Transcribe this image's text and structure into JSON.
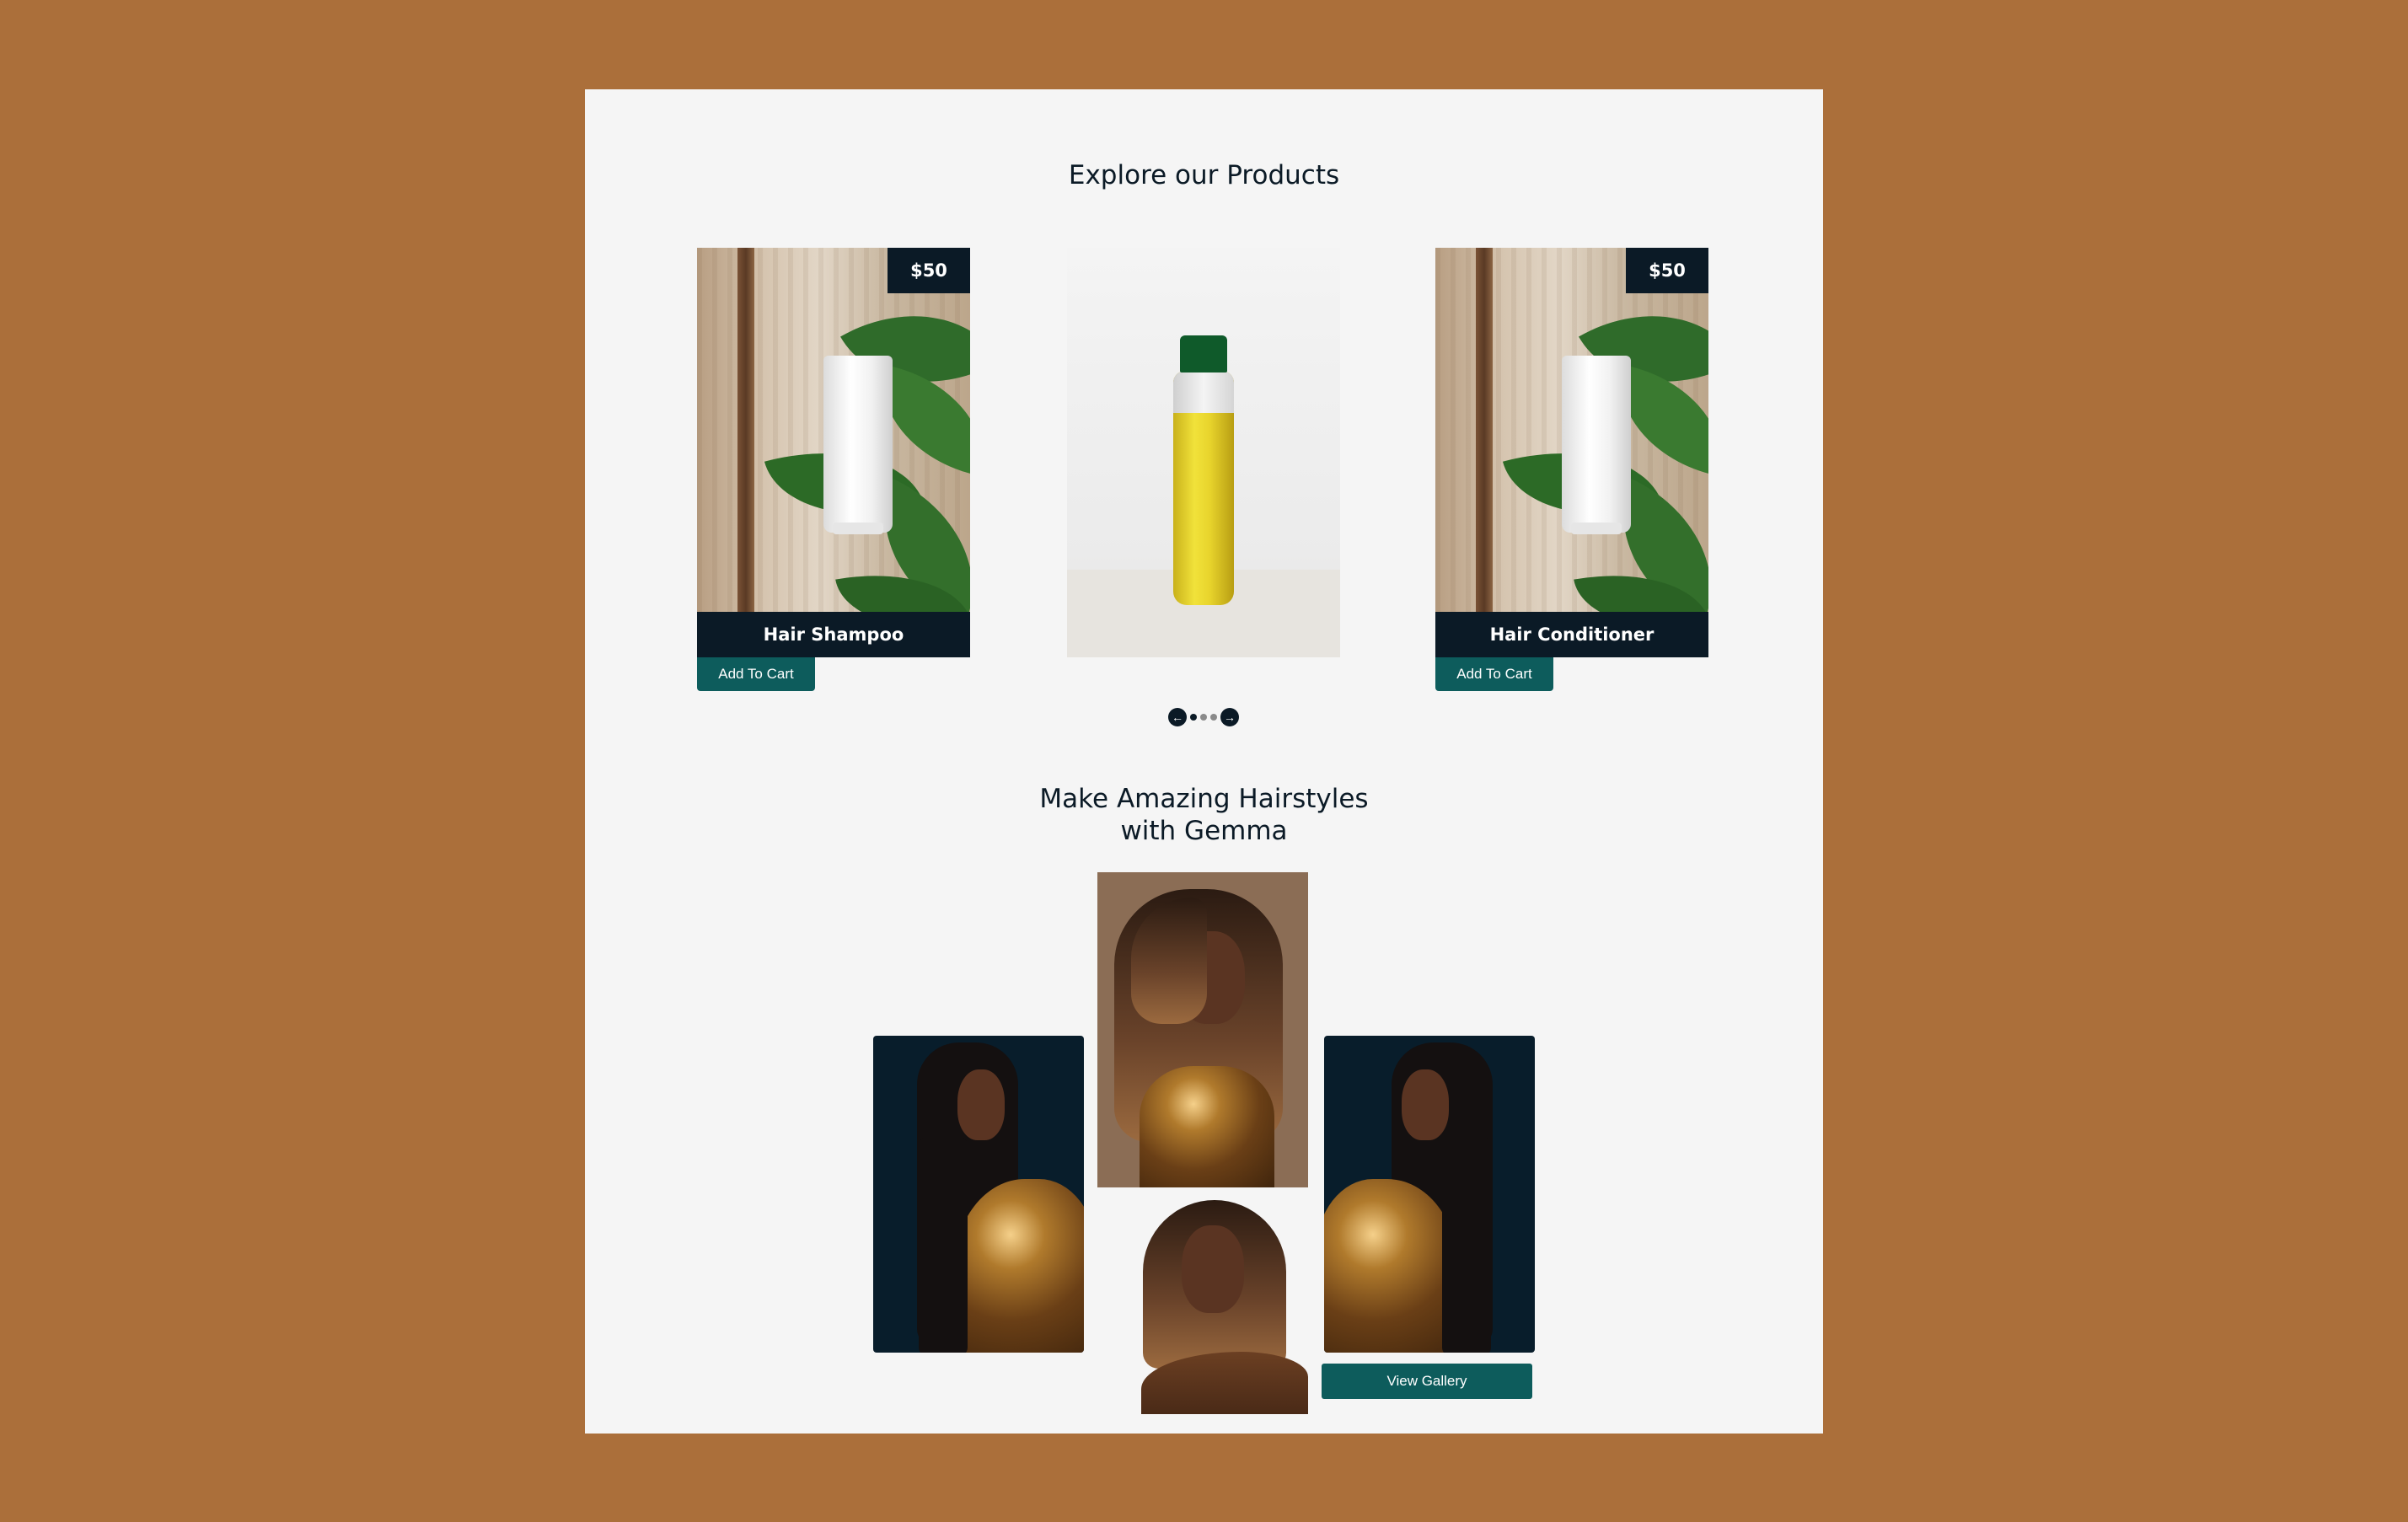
{
  "products": {
    "title": "Explore our Products",
    "items": [
      {
        "name": "Hair Shampoo",
        "price": "$50",
        "button": "Add To Cart",
        "image": "shampoo-tube-on-leaves"
      },
      {
        "name": "",
        "price": "",
        "button": "",
        "image": "yellow-gel-bottle"
      },
      {
        "name": "Hair Conditioner",
        "price": "$50",
        "button": "Add To Cart",
        "image": "conditioner-tube-on-leaves"
      }
    ],
    "carousel": {
      "prev_icon": "arrow-left-icon",
      "next_icon": "arrow-right-icon",
      "dots": 3,
      "active_dot": 1
    }
  },
  "hairstyles": {
    "title_line1": "Make Amazing Hairstyles",
    "title_line2": "with Gemma",
    "gallery_button": "View Gallery"
  },
  "colors": {
    "background": "#ab6f3a",
    "panel": "#f5f5f5",
    "navy": "#0b1a26",
    "teal": "#0d5c5c"
  }
}
